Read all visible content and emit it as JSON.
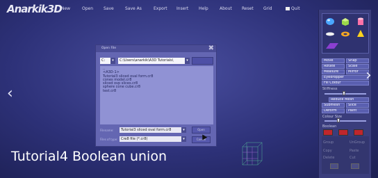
{
  "app": {
    "logo": "Anarkik3D"
  },
  "menu": {
    "items": [
      "New",
      "Open",
      "Save",
      "Save As",
      "Export",
      "Insert",
      "Help",
      "About",
      "Reset",
      "Grid"
    ],
    "quit_label": "Quit"
  },
  "shapes_palette": {
    "icons": [
      "sphere-icon",
      "cube-icon",
      "cylinder-icon",
      "flat-disk-icon",
      "torus-icon",
      "cone-icon",
      "plane-icon"
    ]
  },
  "panel": {
    "buttons_row1": [
      "Move",
      "Snap"
    ],
    "buttons_row2": [
      "Rotate",
      "Scale"
    ],
    "buttons_row3": [
      "Measure",
      "Mirror"
    ],
    "eyedropper": "Eyedropper",
    "fill_colour": "Fill Colour",
    "stiffness_label": "Stiffness",
    "reduce_mesh": "Reduce Mesh",
    "buttons_row4": [
      "Submesh",
      "Slice"
    ],
    "buttons_row5": [
      "Deform",
      "Paint"
    ],
    "colour_size_label": "Colour Size",
    "boolean_label": "Boolean",
    "boolean_colors": [
      "#c0262c",
      "#c0262c",
      "#c0262c"
    ],
    "lower_items_row1": [
      "Group",
      "UnGroup"
    ],
    "lower_items_row2": [
      "Copy",
      "Paste"
    ],
    "lower_items_row3": [
      "Delete",
      "Cut"
    ]
  },
  "dialog": {
    "title": "Open File",
    "drive": "C:",
    "path": "C:\\Users\\anarkik\\A3D Tutorials\\",
    "files": [
      "..",
      "<A3D-1>",
      "Tutorial3 sliced oval form.cr8",
      "cones model.cr8",
      "sliced ovp slices.cr8",
      "sphere cone cube.cr8",
      "test.cr8"
    ],
    "filename_label": "Filename:",
    "filename_value": "Tutorial3 sliced oval form.cr8",
    "filetype_label": "Files of type:",
    "filetype_value": "Cre8 file (*.cr8)",
    "open_button": "Open",
    "cancel_button": "Cancel"
  },
  "caption": "Tutorial4 Boolean union",
  "colors": {
    "background": "#2d3178",
    "panel": "#3a3d7c",
    "dialog": "#6466b2",
    "accent_red": "#c0262c"
  }
}
